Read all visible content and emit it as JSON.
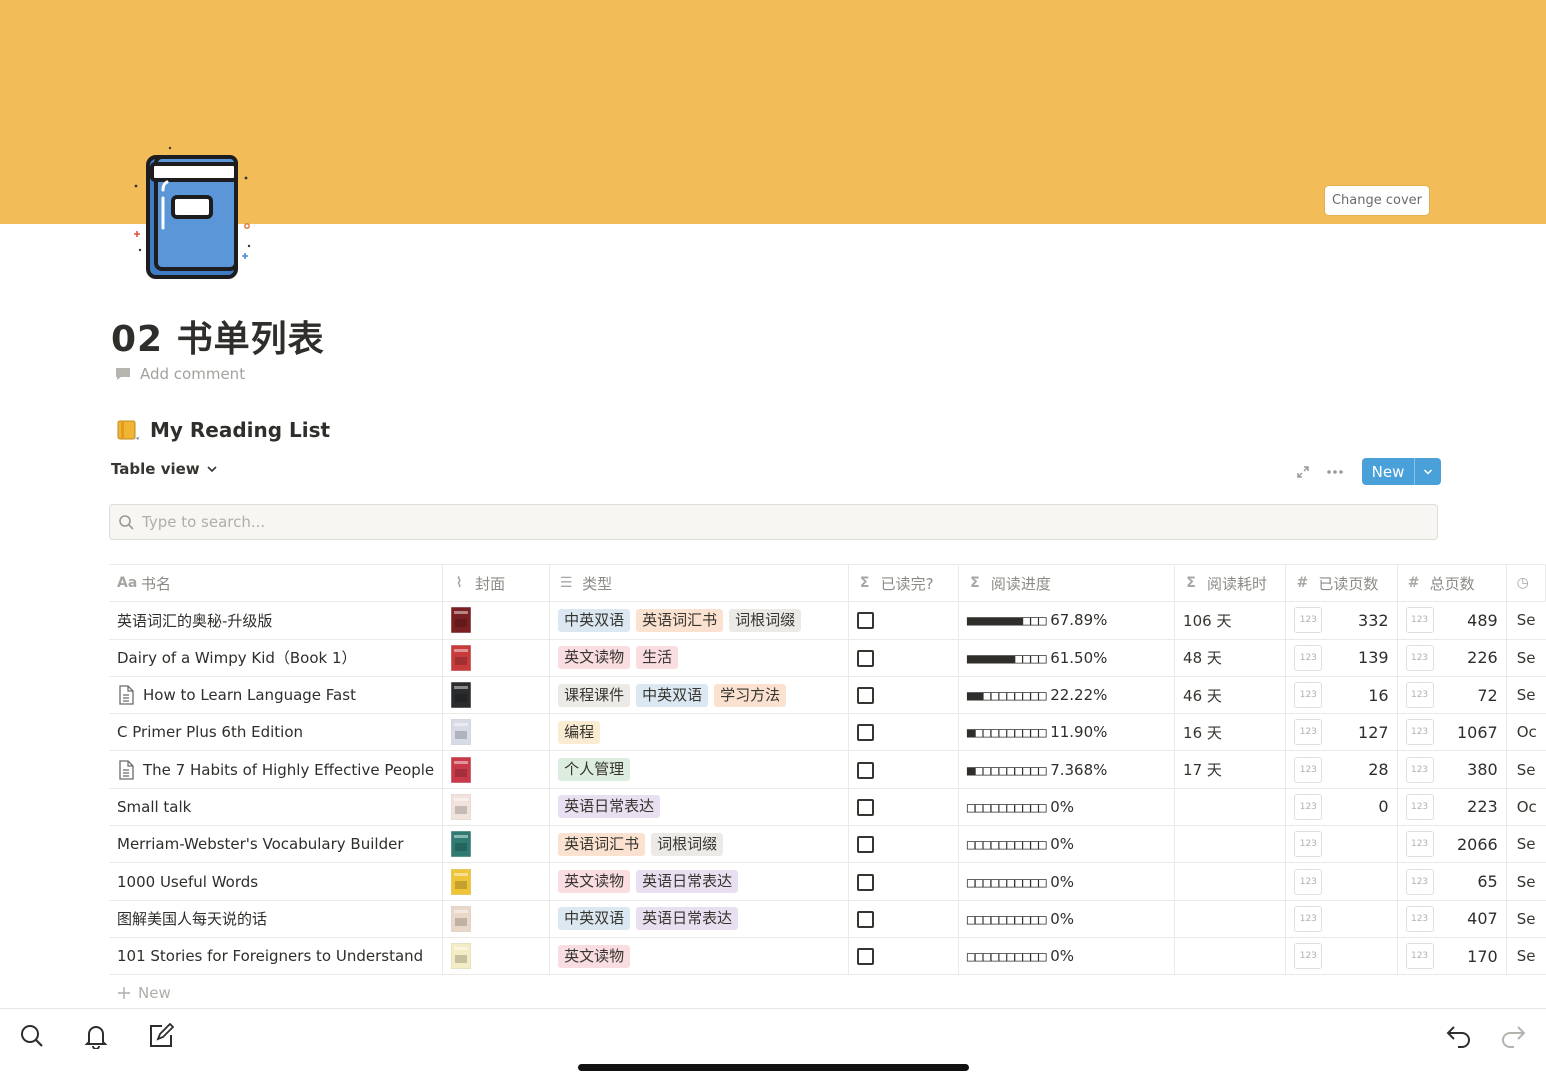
{
  "cover": {
    "color": "#f2bd58",
    "change_cover_label": "Change cover"
  },
  "page": {
    "icon": "book-icon",
    "title": "02 书单列表",
    "add_comment": "Add comment"
  },
  "database": {
    "title": "My Reading List",
    "title_icon": "notebook-icon",
    "view_label": "Table view",
    "new_label": "New",
    "search_placeholder": "Type to search...",
    "add_row_label": "New"
  },
  "columns": [
    "书名",
    "封面",
    "类型",
    "已读完?",
    "阅读进度",
    "阅读耗时",
    "已读页数",
    "总页数"
  ],
  "number_badge": "123",
  "tag_colors": {
    "中英双语": "#dbe8f2",
    "英语词汇书": "#fbe2d0",
    "词根词缀": "#ebeae7",
    "英文读物": "#f9dde0",
    "生活": "#f9dde0",
    "课程课件": "#ebeae7",
    "学习方法": "#fbe2d0",
    "编程": "#f9ecd2",
    "个人管理": "#dcecdf",
    "英语日常表达": "#e8e0f0"
  },
  "rows": [
    {
      "title": "英语词汇的奥秘-升级版",
      "page_icon": false,
      "cover_color": "#7a1f22",
      "tags": [
        "中英双语",
        "英语词汇书",
        "词根词缀"
      ],
      "done": false,
      "filled": 7,
      "pct": "67.89%",
      "time": "106 天",
      "read": "332",
      "total": "489",
      "trunc": "Se"
    },
    {
      "title": "Dairy of a Wimpy Kid（Book 1）",
      "page_icon": false,
      "cover_color": "#c73b3b",
      "tags": [
        "英文读物",
        "生活"
      ],
      "done": false,
      "filled": 6,
      "pct": "61.50%",
      "time": "48 天",
      "read": "139",
      "total": "226",
      "trunc": "Se"
    },
    {
      "title": "How to Learn Language Fast",
      "page_icon": true,
      "cover_color": "#2a2c2e",
      "tags": [
        "课程课件",
        "中英双语",
        "学习方法"
      ],
      "done": false,
      "filled": 2,
      "pct": "22.22%",
      "time": "46 天",
      "read": "16",
      "total": "72",
      "trunc": "Se"
    },
    {
      "title": "C Primer Plus 6th Edition",
      "page_icon": false,
      "cover_color": "#d7dbe6",
      "tags": [
        "编程"
      ],
      "done": false,
      "filled": 1,
      "pct": "11.90%",
      "time": "16 天",
      "read": "127",
      "total": "1067",
      "trunc": "Oc"
    },
    {
      "title": "The 7 Habits of Highly Effective People",
      "page_icon": true,
      "cover_color": "#c9394a",
      "tags": [
        "个人管理"
      ],
      "done": false,
      "filled": 1,
      "pct": "7.368%",
      "time": "17 天",
      "read": "28",
      "total": "380",
      "trunc": "Se"
    },
    {
      "title": "Small talk",
      "page_icon": false,
      "cover_color": "#f1e3dc",
      "tags": [
        "英语日常表达"
      ],
      "done": false,
      "filled": 0,
      "pct": "0%",
      "time": "",
      "read": "0",
      "total": "223",
      "trunc": "Oc"
    },
    {
      "title": "Merriam-Webster's Vocabulary Builder",
      "page_icon": false,
      "cover_color": "#2f7a73",
      "tags": [
        "英语词汇书",
        "词根词缀"
      ],
      "done": false,
      "filled": 0,
      "pct": "0%",
      "time": "",
      "read": "",
      "total": "2066",
      "trunc": "Se"
    },
    {
      "title": "1000 Useful Words",
      "page_icon": false,
      "cover_color": "#f0c437",
      "tags": [
        "英文读物",
        "英语日常表达"
      ],
      "done": false,
      "filled": 0,
      "pct": "0%",
      "time": "",
      "read": "",
      "total": "65",
      "trunc": "Se"
    },
    {
      "title": "图解美国人每天说的话",
      "page_icon": false,
      "cover_color": "#e9d8c8",
      "tags": [
        "中英双语",
        "英语日常表达"
      ],
      "done": false,
      "filled": 0,
      "pct": "0%",
      "time": "",
      "read": "",
      "total": "407",
      "trunc": "Se"
    },
    {
      "title": "101 Stories for Foreigners to Understand",
      "page_icon": false,
      "cover_color": "#f3ecc4",
      "tags": [
        "英文读物"
      ],
      "done": false,
      "filled": 0,
      "pct": "0%",
      "time": "",
      "read": "",
      "total": "170",
      "trunc": "Se"
    }
  ],
  "bottom_bar": {
    "left_icons": [
      "search-icon",
      "bell-icon",
      "compose-icon"
    ],
    "right_icons": [
      "undo-icon",
      "redo-icon"
    ]
  }
}
